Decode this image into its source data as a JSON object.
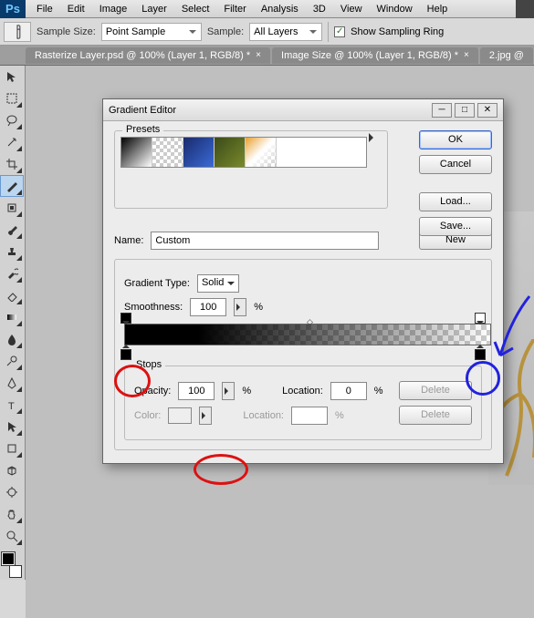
{
  "app": {
    "logo_text": "Ps"
  },
  "menus": [
    "File",
    "Edit",
    "Image",
    "Layer",
    "Select",
    "Filter",
    "Analysis",
    "3D",
    "View",
    "Window",
    "Help"
  ],
  "options": {
    "sample_size_label": "Sample Size:",
    "sample_size_value": "Point Sample",
    "sample_label": "Sample:",
    "sample_value": "All Layers",
    "show_ring_label": "Show Sampling Ring",
    "show_ring_checked": "✓"
  },
  "tabs": [
    "Rasterize Layer.psd @ 100% (Layer 1, RGB/8) *",
    "Image Size @ 100% (Layer 1, RGB/8) *",
    "2.jpg @"
  ],
  "dialog": {
    "title": "Gradient Editor",
    "ok": "OK",
    "cancel": "Cancel",
    "load": "Load...",
    "save": "Save...",
    "new": "New",
    "presets_label": "Presets",
    "name_label": "Name:",
    "name_value": "Custom",
    "grad_type_label": "Gradient Type:",
    "grad_type_value": "Solid",
    "smoothness_label": "Smoothness:",
    "smoothness_value": "100",
    "smoothness_unit": "%",
    "stops_label": "Stops",
    "opacity_label": "Opacity:",
    "opacity_value": "100",
    "opacity_unit": "%",
    "location_label": "Location:",
    "location_value": "0",
    "location_unit": "%",
    "delete_label": "Delete",
    "color_label": "Color:",
    "location2_label": "Location:",
    "location2_unit": "%"
  }
}
